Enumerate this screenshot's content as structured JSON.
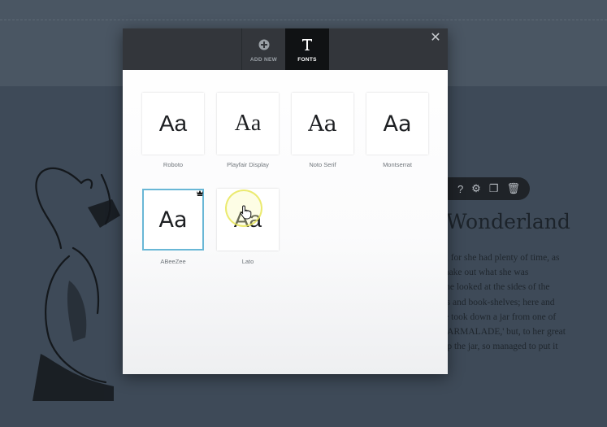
{
  "tabs": [
    {
      "label": "ADD NEW",
      "icon": "plus-circle-icon"
    },
    {
      "label": "FONTS",
      "icon": "text-t-icon",
      "active": true
    }
  ],
  "close_icon": "close-icon",
  "fonts": [
    {
      "name": "Roboto",
      "sample": "Aa"
    },
    {
      "name": "Playfair Display",
      "sample": "Aa"
    },
    {
      "name": "Noto Serif",
      "sample": "Aa"
    },
    {
      "name": "Montserrat",
      "sample": "Aa"
    },
    {
      "name": "ABeeZee",
      "sample": "Aa",
      "selected": true,
      "badge": "crown-icon"
    },
    {
      "name": "Lato",
      "sample": "Aa"
    }
  ],
  "background": {
    "heading": "Wonderland",
    "paragraph": [
      "vly, for she had plenty of time, as",
      "o make out what she was",
      "n she looked at the sides of the",
      "ards and book-shelves; here and",
      "She took down a jar from one of",
      "' MARMALADE,' but, to her great",
      "drop the jar, so managed to put it"
    ],
    "toolbar_icons": [
      "help-icon",
      "gear-icon",
      "copy-icon",
      "trash-icon"
    ]
  },
  "colors": {
    "header": "#33363b",
    "active_tab": "#101214",
    "selected_border": "#69b7d6",
    "backdrop": "#3e4a58"
  }
}
